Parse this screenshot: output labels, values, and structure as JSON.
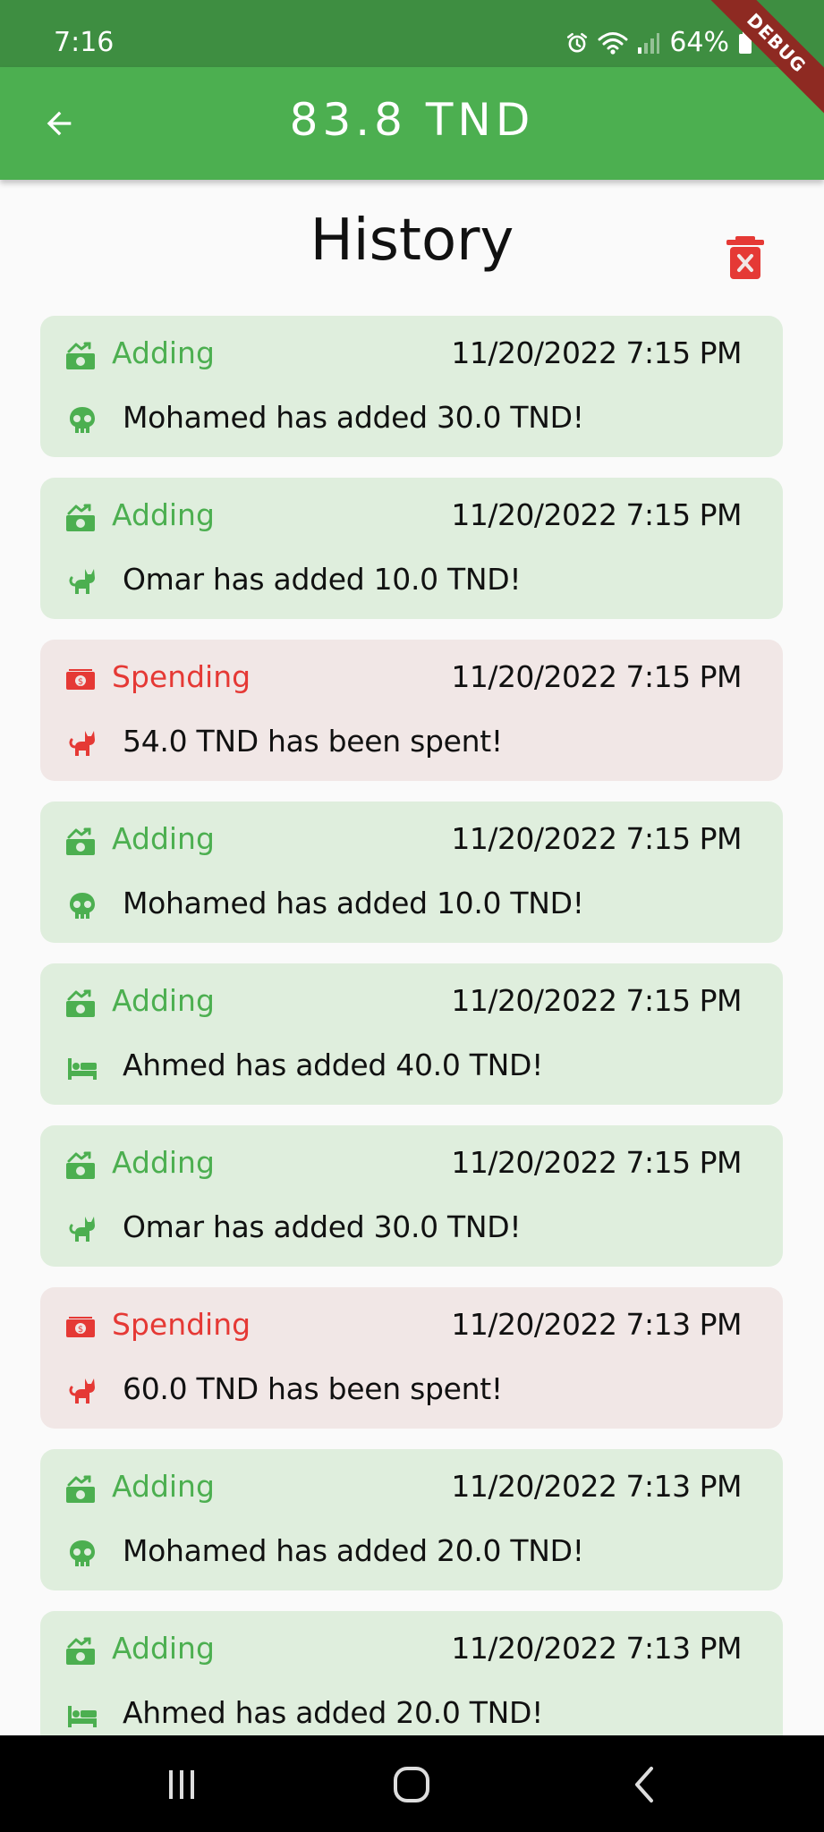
{
  "status_bar": {
    "time": "7:16",
    "battery": "64%",
    "debug_label": "DEBUG"
  },
  "app_bar": {
    "balance": "83.8  TND",
    "back_icon": "arrow-back-icon"
  },
  "page": {
    "title": "History",
    "clear_icon": "delete-forever-icon"
  },
  "colors": {
    "app_bar": "#4caf50",
    "status_bar": "#3e8e41",
    "adding": "#4caf50",
    "spending": "#e53935",
    "adding_bg": "#dfeedd",
    "spending_bg": "#f1e7e6"
  },
  "history": [
    {
      "type": "adding",
      "label": "Adding",
      "timestamp": "11/20/2022 7:15 PM",
      "member_icon": "skull-icon",
      "message": "Mohamed has added 30.0 TND!"
    },
    {
      "type": "adding",
      "label": "Adding",
      "timestamp": "11/20/2022 7:15 PM",
      "member_icon": "cat-icon",
      "message": "Omar has added 10.0 TND!"
    },
    {
      "type": "spending",
      "label": "Spending",
      "timestamp": "11/20/2022 7:15 PM",
      "member_icon": "cat-icon",
      "message": "54.0 TND has been spent!"
    },
    {
      "type": "adding",
      "label": "Adding",
      "timestamp": "11/20/2022 7:15 PM",
      "member_icon": "skull-icon",
      "message": "Mohamed has added 10.0 TND!"
    },
    {
      "type": "adding",
      "label": "Adding",
      "timestamp": "11/20/2022 7:15 PM",
      "member_icon": "bed-icon",
      "message": "Ahmed has added 40.0 TND!"
    },
    {
      "type": "adding",
      "label": "Adding",
      "timestamp": "11/20/2022 7:15 PM",
      "member_icon": "cat-icon",
      "message": "Omar has added 30.0 TND!"
    },
    {
      "type": "spending",
      "label": "Spending",
      "timestamp": "11/20/2022 7:13 PM",
      "member_icon": "cat-icon",
      "message": "60.0 TND has been spent!"
    },
    {
      "type": "adding",
      "label": "Adding",
      "timestamp": "11/20/2022 7:13 PM",
      "member_icon": "skull-icon",
      "message": "Mohamed has added 20.0 TND!"
    },
    {
      "type": "adding",
      "label": "Adding",
      "timestamp": "11/20/2022 7:13 PM",
      "member_icon": "bed-icon",
      "message": "Ahmed has added 20.0 TND!"
    }
  ],
  "nav_bar": {
    "recents_icon": "recents-icon",
    "home_icon": "home-icon",
    "back_icon": "nav-back-icon"
  }
}
